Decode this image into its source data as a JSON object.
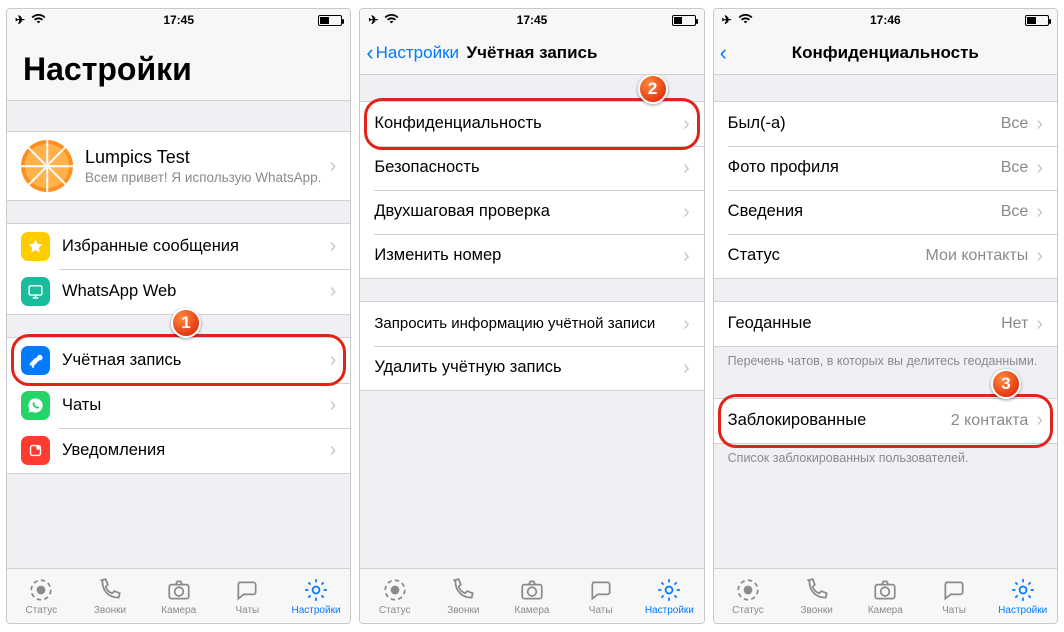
{
  "statusbar": {
    "time1": "17:45",
    "time2": "17:45",
    "time3": "17:46"
  },
  "screen1": {
    "title": "Настройки",
    "profile": {
      "name": "Lumpics Test",
      "status": "Всем привет! Я использую WhatsApp."
    },
    "group_a": [
      {
        "label": "Избранные сообщения"
      },
      {
        "label": "WhatsApp Web"
      }
    ],
    "group_b": [
      {
        "label": "Учётная запись"
      },
      {
        "label": "Чаты"
      },
      {
        "label": "Уведомления"
      }
    ],
    "badge": "1"
  },
  "screen2": {
    "back": "Настройки",
    "title": "Учётная запись",
    "group_a": [
      {
        "label": "Конфиденциальность"
      },
      {
        "label": "Безопасность"
      },
      {
        "label": "Двухшаговая проверка"
      },
      {
        "label": "Изменить номер"
      }
    ],
    "group_b": [
      {
        "label": "Запросить информацию учётной записи"
      },
      {
        "label": "Удалить учётную запись"
      }
    ],
    "badge": "2"
  },
  "screen3": {
    "title": "Конфиденциальность",
    "group_a": [
      {
        "label": "Был(-а)",
        "value": "Все"
      },
      {
        "label": "Фото профиля",
        "value": "Все"
      },
      {
        "label": "Сведения",
        "value": "Все"
      },
      {
        "label": "Статус",
        "value": "Мои контакты"
      }
    ],
    "group_b": [
      {
        "label": "Геоданные",
        "value": "Нет"
      }
    ],
    "note_b": "Перечень чатов, в которых вы делитесь геоданными.",
    "group_c": [
      {
        "label": "Заблокированные",
        "value": "2 контакта"
      }
    ],
    "note_c": "Список заблокированных пользователей.",
    "badge": "3"
  },
  "tabs": {
    "status": "Статус",
    "calls": "Звонки",
    "camera": "Камера",
    "chats": "Чаты",
    "settings": "Настройки"
  }
}
